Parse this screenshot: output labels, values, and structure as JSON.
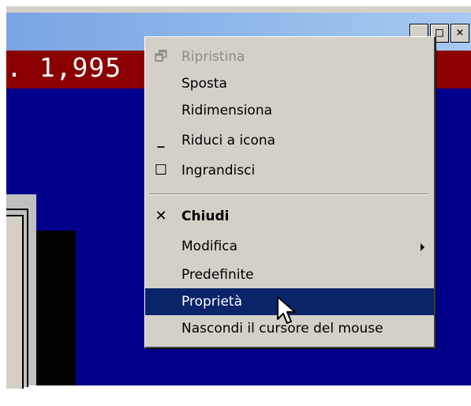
{
  "window": {
    "buttons": {
      "minimize": "_",
      "maximize": "□",
      "close": "×"
    },
    "ticker_text": ". 1,995"
  },
  "menu": {
    "items": [
      {
        "label": "Ripristina",
        "icon": "restore-icon",
        "glyph": "🗗",
        "enabled": false
      },
      {
        "label": "Sposta",
        "icon": "",
        "glyph": "",
        "enabled": true
      },
      {
        "label": "Ridimensiona",
        "icon": "",
        "glyph": "",
        "enabled": true
      },
      {
        "label": "Riduci a icona",
        "icon": "minimize-icon",
        "glyph": "_",
        "enabled": true
      },
      {
        "label": "Ingrandisci",
        "icon": "maximize-icon",
        "glyph": "☐",
        "enabled": true
      },
      {
        "label": "Chiudi",
        "icon": "close-icon",
        "glyph": "✕",
        "enabled": true,
        "bold": true
      },
      {
        "label": "Modifica",
        "icon": "",
        "glyph": "",
        "enabled": true,
        "submenu": true
      },
      {
        "label": "Predefinite",
        "icon": "",
        "glyph": "",
        "enabled": true
      },
      {
        "label": "Proprietà",
        "icon": "",
        "glyph": "",
        "enabled": true,
        "highlighted": true
      },
      {
        "label": "Nascondi il cursore del mouse",
        "icon": "",
        "glyph": "",
        "enabled": true
      }
    ]
  },
  "colors": {
    "client_bg": "#00008b",
    "ticker_bg": "#8b0000",
    "menu_bg": "#d4d0c8",
    "highlight": "#0a246a"
  }
}
